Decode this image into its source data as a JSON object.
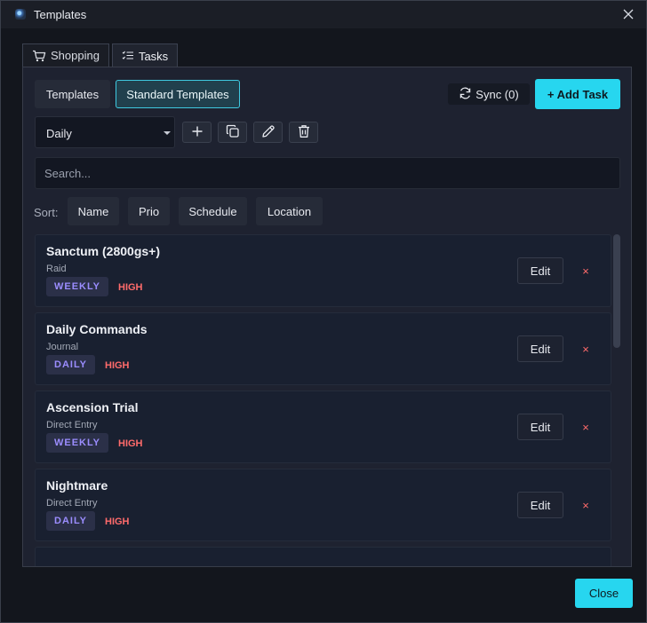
{
  "window": {
    "title": "Templates"
  },
  "tabs": [
    {
      "label": "Shopping",
      "icon": "cart-icon",
      "active": false
    },
    {
      "label": "Tasks",
      "icon": "list-icon",
      "active": true
    }
  ],
  "toolbar": {
    "templates_label": "Templates",
    "standard_templates_label": "Standard Templates",
    "sync_label": "Sync (0)",
    "add_task_label": "+ Add Task"
  },
  "template_select": {
    "value": "Daily"
  },
  "search": {
    "placeholder": "Search...",
    "value": ""
  },
  "sort": {
    "label": "Sort:",
    "options": [
      "Name",
      "Prio",
      "Schedule",
      "Location"
    ]
  },
  "tasks": [
    {
      "name": "Sanctum (2800gs+)",
      "category": "Raid",
      "schedule": "WEEKLY",
      "priority": "HIGH",
      "edit_label": "Edit",
      "delete_label": "×"
    },
    {
      "name": "Daily Commands",
      "category": "Journal",
      "schedule": "DAILY",
      "priority": "HIGH",
      "edit_label": "Edit",
      "delete_label": "×"
    },
    {
      "name": "Ascension Trial",
      "category": "Direct Entry",
      "schedule": "WEEKLY",
      "priority": "HIGH",
      "edit_label": "Edit",
      "delete_label": "×"
    },
    {
      "name": "Nightmare",
      "category": "Direct Entry",
      "schedule": "DAILY",
      "priority": "HIGH",
      "edit_label": "Edit",
      "delete_label": "×"
    }
  ],
  "footer": {
    "close_label": "Close"
  },
  "colors": {
    "accent": "#27d6ef",
    "badge_text": "#9b8dff",
    "priority_high": "#ff6b6b",
    "panel_bg": "#1e2230"
  }
}
